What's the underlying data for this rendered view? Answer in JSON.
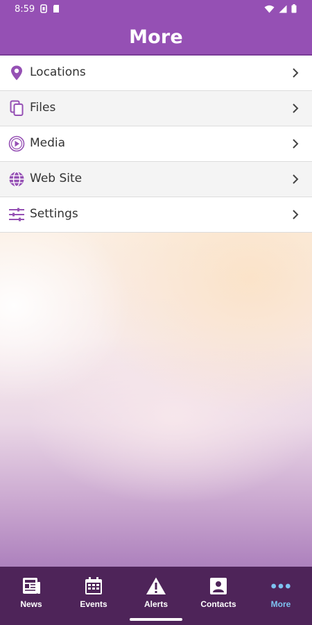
{
  "status_bar": {
    "time": "8:59"
  },
  "header": {
    "title": "More"
  },
  "menu": {
    "items": [
      {
        "label": "Locations",
        "icon": "location-pin-icon"
      },
      {
        "label": "Files",
        "icon": "files-icon"
      },
      {
        "label": "Media",
        "icon": "play-circle-icon"
      },
      {
        "label": "Web Site",
        "icon": "globe-icon"
      },
      {
        "label": "Settings",
        "icon": "sliders-icon"
      }
    ]
  },
  "tabs": [
    {
      "label": "News",
      "icon": "newspaper-icon",
      "active": false
    },
    {
      "label": "Events",
      "icon": "calendar-icon",
      "active": false
    },
    {
      "label": "Alerts",
      "icon": "alert-icon",
      "active": false
    },
    {
      "label": "Contacts",
      "icon": "contact-card-icon",
      "active": false
    },
    {
      "label": "More",
      "icon": "more-dots-icon",
      "active": true
    }
  ],
  "colors": {
    "brand": "#9550b4",
    "tab_bar": "#4e2459",
    "active_tab": "#7ec3f1",
    "icon_accent": "#9550b4"
  }
}
